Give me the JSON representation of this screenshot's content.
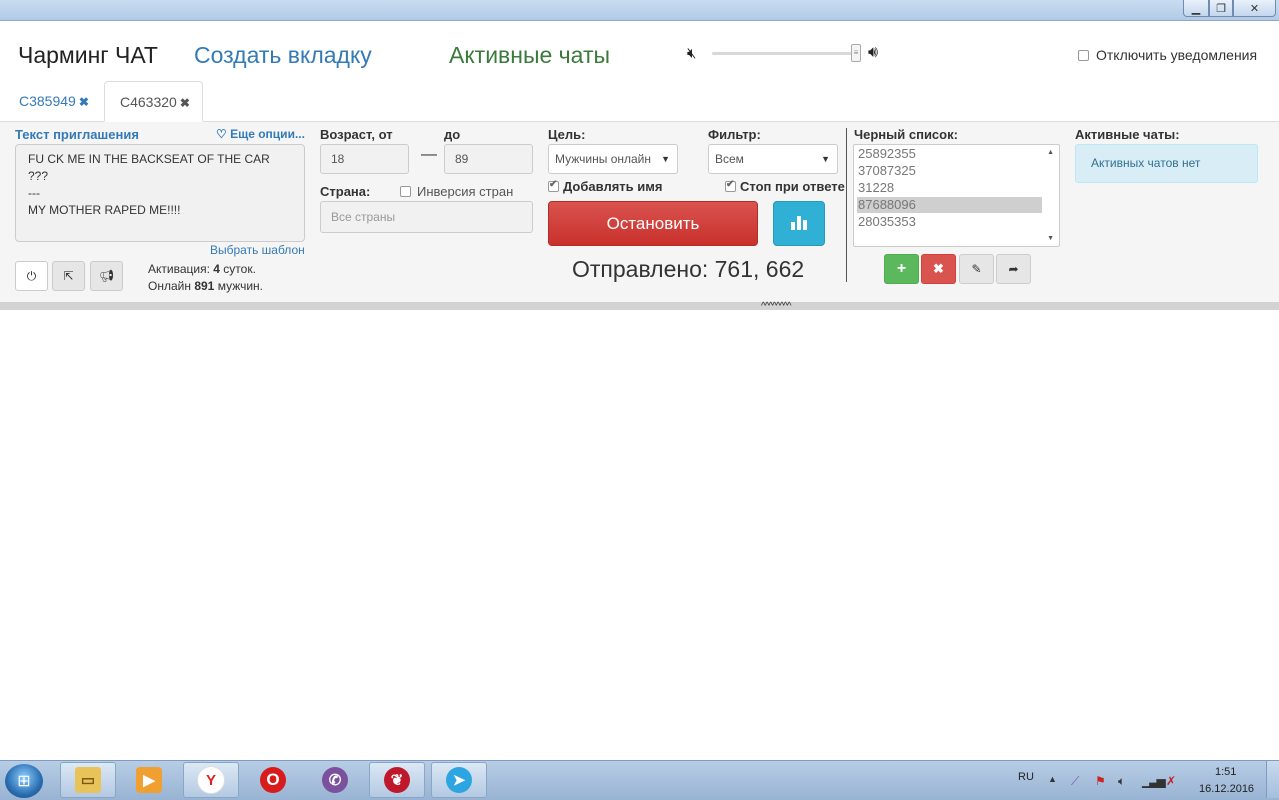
{
  "header": {
    "app_title": "Чарминг ЧАТ",
    "create_tab": "Создать вкладку",
    "active_chats": "Активные чаты",
    "notifications_label": "Отключить уведомления"
  },
  "tabs": [
    {
      "label": "C385949",
      "active": false
    },
    {
      "label": "C463320",
      "active": true
    }
  ],
  "invite": {
    "label": "Текст приглашения",
    "more_options": "Еще опции...",
    "text": "FU CK ME IN THE BACKSEAT OF THE CAR\n???\n---\nMY MOTHER RAPED ME!!!!",
    "choose_template": "Выбрать шаблон"
  },
  "activation": {
    "prefix": "Активация:",
    "days": "4",
    "days_suffix": "суток.",
    "online_prefix": "Онлайн",
    "online_count": "891",
    "online_suffix": "мужчин."
  },
  "age": {
    "label_from": "Возраст, от",
    "label_to": "до",
    "from": "18",
    "to": "89"
  },
  "country": {
    "label": "Страна:",
    "inversion_label": "Инверсия стран",
    "inversion_checked": false,
    "placeholder": "Все страны"
  },
  "goal": {
    "label": "Цель:",
    "value": "Мужчины онлайн",
    "add_name_label": "Добавлять имя",
    "add_name_checked": true
  },
  "filter": {
    "label": "Фильтр:",
    "value": "Всем",
    "stop_on_reply_label": "Стоп при ответе",
    "stop_on_reply_checked": true
  },
  "actions": {
    "stop_label": "Остановить",
    "sent_text": "Отправлено: 761, 662"
  },
  "blacklist": {
    "label": "Черный список:",
    "items": [
      "25892355",
      "37087325",
      "31228",
      "87688096",
      "28035353"
    ],
    "selected_index": 3
  },
  "active_panel": {
    "label": "Активные чаты:",
    "empty_text": "Активных чатов нет"
  },
  "taskbar": {
    "lang": "RU",
    "time": "1:51",
    "date": "16.12.2016"
  },
  "colors": {
    "link": "#337ab7",
    "active_chats": "#3c7a3c",
    "stop_button": "#d9534f",
    "stats_button": "#31b0d5",
    "add_button": "#5cb85c"
  }
}
